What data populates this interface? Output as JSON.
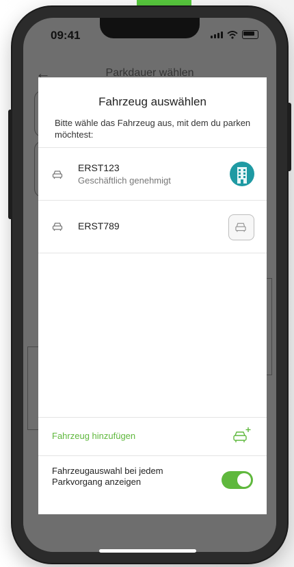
{
  "status_bar": {
    "time": "09:41"
  },
  "background": {
    "header_title": "Parkdauer wählen",
    "back_icon": "arrow-left-icon"
  },
  "sheet": {
    "title": "Fahrzeug auswählen",
    "subtitle": "Bitte wähle das Fahrzeug aus, mit dem du parken möchtest:",
    "vehicles": [
      {
        "plate": "ERST123",
        "status": "Geschäftlich genehmigt",
        "badge_icon": "company-building-icon"
      },
      {
        "plate": "ERST789",
        "status": "",
        "badge_icon": "car-icon"
      }
    ],
    "add_vehicle_label": "Fahrzeug hinzufügen",
    "toggle_label": "Fahrzeugauswahl bei jedem Parkvorgang anzeigen",
    "toggle_on": true
  },
  "colors": {
    "accent": "#5fb83d",
    "company_badge": "#1f9aa3"
  }
}
